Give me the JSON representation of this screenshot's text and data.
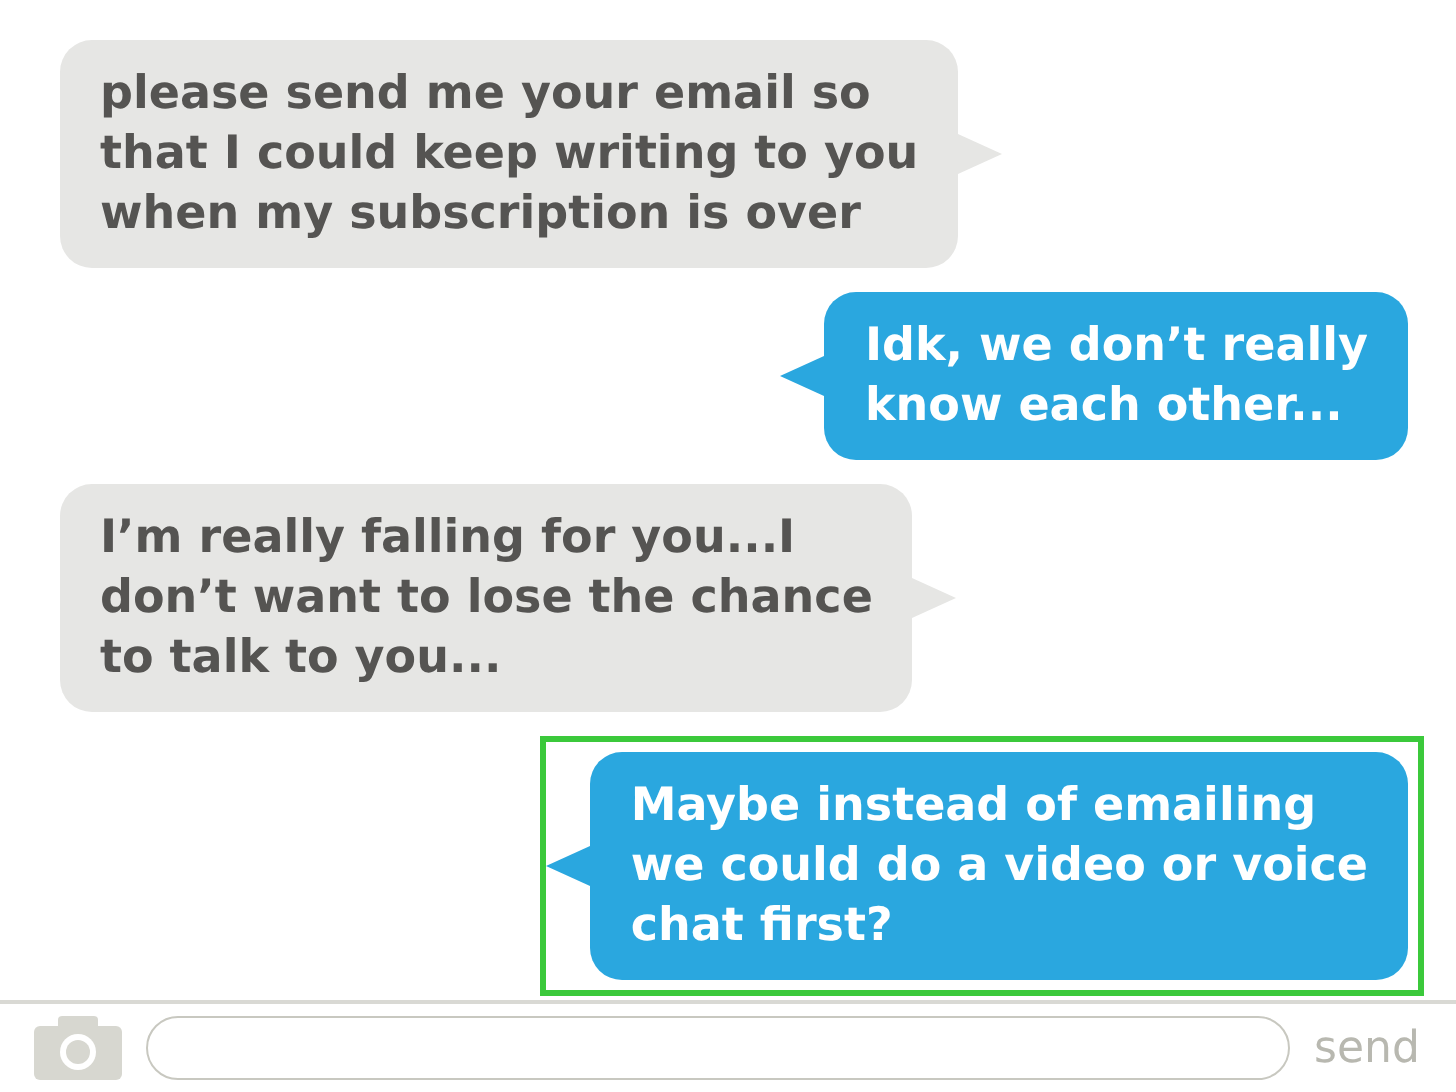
{
  "messages": [
    {
      "kind": "received",
      "text": "please send me your email so\nthat I could keep writing to you\nwhen my subscription is over",
      "highlighted": false
    },
    {
      "kind": "sent",
      "text": "Idk, we don’t really\nknow each other...",
      "highlighted": false
    },
    {
      "kind": "received",
      "text": "I’m really falling for you...I\ndon’t want to lose the chance\nto talk to you...",
      "highlighted": false
    },
    {
      "kind": "sent",
      "text": "Maybe instead of emailing\nwe could do a video or voice\nchat first?",
      "highlighted": true
    }
  ],
  "composer": {
    "send": "send"
  }
}
